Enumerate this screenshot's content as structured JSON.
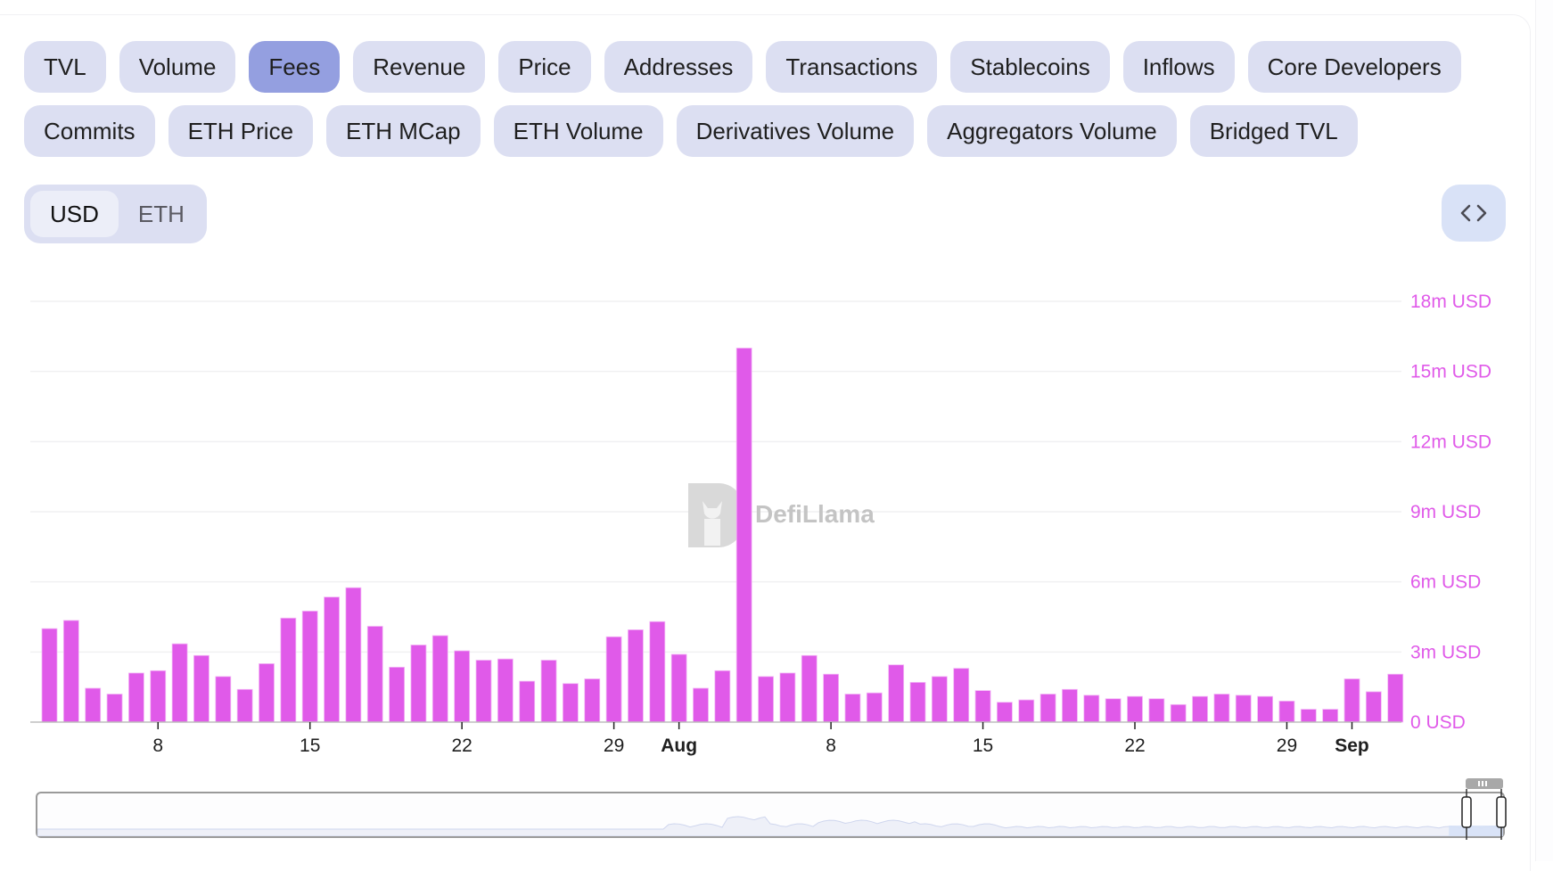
{
  "metric_tabs": {
    "row1": [
      "TVL",
      "Volume",
      "Fees",
      "Revenue",
      "Price",
      "Addresses",
      "Transactions",
      "Stablecoins",
      "Inflows",
      "Core Developers"
    ],
    "row2": [
      "Commits",
      "ETH Price",
      "ETH MCap",
      "ETH Volume",
      "Derivatives Volume",
      "Aggregators Volume",
      "Bridged TVL"
    ],
    "active": "Fees"
  },
  "denomination": {
    "options": [
      "USD",
      "ETH"
    ],
    "active": "USD"
  },
  "embed_button": {
    "icon": "code-brackets-icon"
  },
  "watermark": {
    "text": "DefiLlama"
  },
  "colors": {
    "bar": "#e05ae9",
    "active_tab": "#949fe0",
    "tab": "#dcdff2",
    "axis_label": "#e05ae9",
    "embed_button": "#d9e2f7"
  },
  "chart_data": {
    "type": "bar",
    "title": "",
    "xlabel": "",
    "ylabel": "",
    "series": [
      {
        "name": "Fees",
        "unit": "USD",
        "categories": [
          "Jul 3",
          "Jul 4",
          "Jul 5",
          "Jul 6",
          "Jul 7",
          "Jul 8",
          "Jul 9",
          "Jul 10",
          "Jul 11",
          "Jul 12",
          "Jul 13",
          "Jul 14",
          "Jul 15",
          "Jul 16",
          "Jul 17",
          "Jul 18",
          "Jul 19",
          "Jul 20",
          "Jul 21",
          "Jul 22",
          "Jul 23",
          "Jul 24",
          "Jul 25",
          "Jul 26",
          "Jul 27",
          "Jul 28",
          "Jul 29",
          "Jul 30",
          "Jul 31",
          "Aug 1",
          "Aug 2",
          "Aug 3",
          "Aug 4",
          "Aug 5",
          "Aug 6",
          "Aug 7",
          "Aug 8",
          "Aug 9",
          "Aug 10",
          "Aug 11",
          "Aug 12",
          "Aug 13",
          "Aug 14",
          "Aug 15",
          "Aug 16",
          "Aug 17",
          "Aug 18",
          "Aug 19",
          "Aug 20",
          "Aug 21",
          "Aug 22",
          "Aug 23",
          "Aug 24",
          "Aug 25",
          "Aug 26",
          "Aug 27",
          "Aug 28",
          "Aug 29",
          "Aug 30",
          "Aug 31",
          "Sep 1",
          "Sep 2",
          "Sep 3"
        ],
        "values_millions": [
          4.0,
          4.35,
          1.45,
          1.2,
          2.1,
          2.2,
          3.35,
          2.85,
          1.95,
          1.4,
          2.5,
          4.45,
          4.75,
          5.35,
          5.75,
          4.1,
          2.35,
          3.3,
          3.7,
          3.05,
          2.65,
          2.7,
          1.75,
          2.65,
          1.65,
          1.85,
          3.65,
          3.95,
          4.3,
          2.9,
          1.45,
          2.2,
          16.0,
          1.95,
          2.1,
          2.85,
          2.05,
          1.2,
          1.25,
          2.45,
          1.7,
          1.95,
          2.3,
          1.35,
          0.85,
          0.95,
          1.2,
          1.4,
          1.15,
          1.0,
          1.1,
          1.0,
          0.75,
          1.1,
          1.2,
          1.15,
          1.1,
          0.9,
          0.55,
          0.55,
          1.85,
          1.3,
          2.05
        ]
      }
    ],
    "y_ticks": [
      {
        "value": 0,
        "label": "0 USD"
      },
      {
        "value": 3,
        "label": "3m USD"
      },
      {
        "value": 6,
        "label": "6m USD"
      },
      {
        "value": 9,
        "label": "9m USD"
      },
      {
        "value": 12,
        "label": "12m USD"
      },
      {
        "value": 15,
        "label": "15m USD"
      },
      {
        "value": 18,
        "label": "18m USD"
      }
    ],
    "ylim": [
      0,
      18
    ],
    "y_axis_position": "right",
    "x_ticks": [
      {
        "index": 5,
        "label": "8",
        "bold": false
      },
      {
        "index": 12,
        "label": "15",
        "bold": false
      },
      {
        "index": 19,
        "label": "22",
        "bold": false
      },
      {
        "index": 26,
        "label": "29",
        "bold": false
      },
      {
        "index": 29,
        "label": "Aug",
        "bold": true
      },
      {
        "index": 36,
        "label": "8",
        "bold": false
      },
      {
        "index": 43,
        "label": "15",
        "bold": false
      },
      {
        "index": 50,
        "label": "22",
        "bold": false
      },
      {
        "index": 57,
        "label": "29",
        "bold": false
      },
      {
        "index": 60,
        "label": "Sep",
        "bold": true
      }
    ],
    "grid": true,
    "legend": "none"
  },
  "range_slider": {
    "start_fraction": 0.963,
    "end_fraction": 1.0
  }
}
